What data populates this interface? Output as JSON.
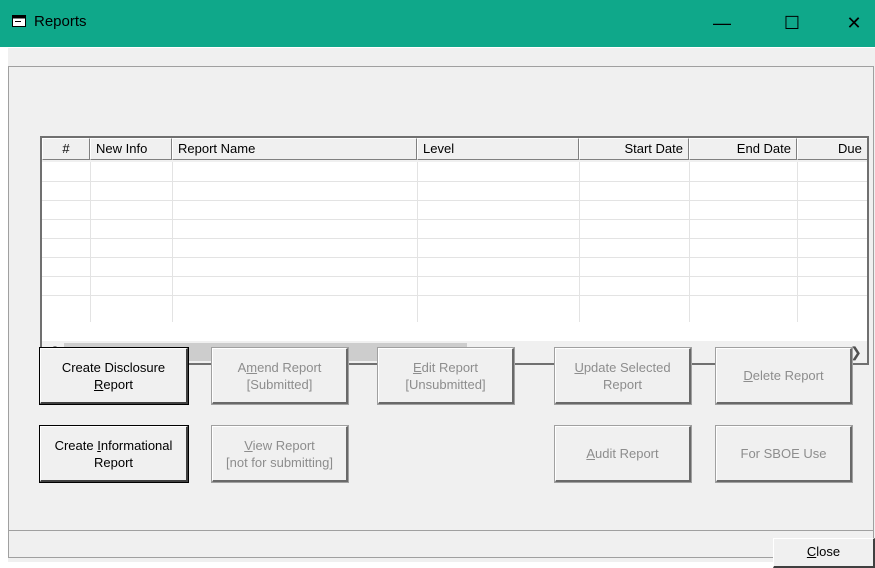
{
  "window": {
    "title": "Reports",
    "minimize_glyph": "—",
    "maximize_glyph": "☐",
    "close_glyph": "✕"
  },
  "grid": {
    "columns": [
      "#",
      "New Info",
      "Report Name",
      "Level",
      "Start Date",
      "End Date",
      "Due"
    ],
    "rows": []
  },
  "buttons": {
    "create_disclosure": {
      "pre": "Create Disclosure",
      "line2_u": "R",
      "line2_rest": "eport"
    },
    "amend": {
      "pre": "A",
      "u": "m",
      "post": "end Report",
      "line2": "[Submitted]"
    },
    "edit": {
      "u": "E",
      "post": "dit Report",
      "line2": "[Unsubmitted]"
    },
    "update": {
      "u": "U",
      "post": "pdate Selected",
      "line2": "Report"
    },
    "delete": {
      "u": "D",
      "post": "elete Report"
    },
    "create_informational": {
      "pre": "Create ",
      "u": "I",
      "post": "nformational",
      "line2": "Report"
    },
    "view": {
      "u": "V",
      "post": "iew Report",
      "line2": "[not for submitting]"
    },
    "audit": {
      "u": "A",
      "post": "udit Report"
    },
    "sboe": {
      "label": "For SBOE Use"
    },
    "close": {
      "u": "C",
      "post": "lose"
    }
  },
  "colors": {
    "titlebar": "#0fa88a",
    "disabled_text": "#8d8d8d"
  },
  "icons": {
    "app": "window-icon",
    "scroll_left": "chevron-left-icon",
    "scroll_right": "chevron-right-icon"
  }
}
